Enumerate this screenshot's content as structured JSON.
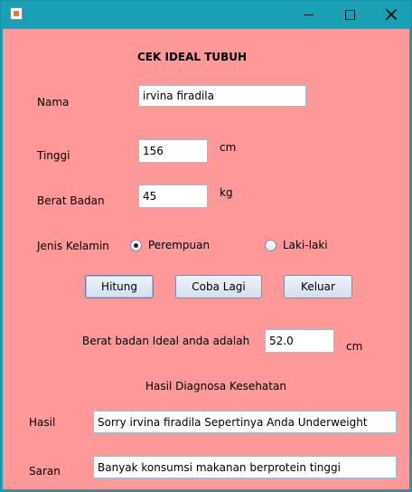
{
  "window": {
    "app_icon": "java-cup-icon",
    "controls": [
      "minimize-icon",
      "maximize-icon",
      "close-icon"
    ]
  },
  "form": {
    "title": "CEK IDEAL TUBUH",
    "nama": {
      "label": "Nama",
      "value": "irvina firadila"
    },
    "tinggi": {
      "label": "Tinggi",
      "value": "156",
      "unit": "cm"
    },
    "berat": {
      "label": "Berat Badan",
      "value": "45",
      "unit": "kg"
    },
    "jenis_kelamin": {
      "label": "Jenis Kelamin",
      "options": [
        {
          "label": "Perempuan",
          "selected": true
        },
        {
          "label": "Laki-laki",
          "selected": false
        }
      ]
    },
    "buttons": {
      "hitung": "Hitung",
      "coba_lagi": "Coba Lagi",
      "keluar": "Keluar"
    },
    "ideal": {
      "label": "Berat badan Ideal anda adalah",
      "value": "52.0",
      "unit": "cm"
    },
    "diagnosa_heading": "Hasil Diagnosa Kesehatan",
    "hasil": {
      "label": "Hasil",
      "value": "Sorry  irvina firadila  Sepertinya Anda Underweight"
    },
    "saran": {
      "label": "Saran",
      "value": "Banyak konsumsi makanan berprotein tinggi"
    }
  },
  "colors": {
    "background": "#ff9999",
    "titlebar": "#1aa0b4"
  }
}
